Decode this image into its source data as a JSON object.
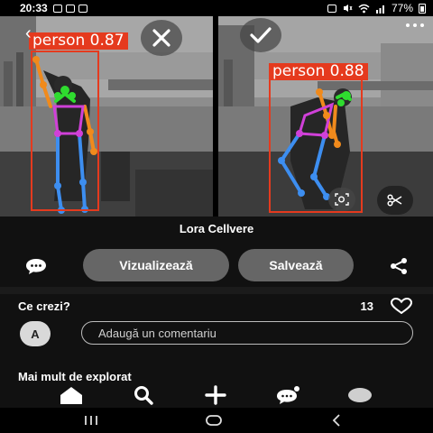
{
  "status_bar": {
    "time": "20:33",
    "battery": "77%",
    "left_icons": [
      "gallery-icon",
      "image-icon",
      "mail-icon"
    ],
    "right_icons": [
      "camera-icon",
      "mute-icon",
      "wifi-icon",
      "signal-icon",
      "battery-icon"
    ]
  },
  "photo_left": {
    "detection_label": "person 0.87",
    "action_icon": "close-icon"
  },
  "photo_right": {
    "detection_label": "person 0.88",
    "action_icon": "check-icon",
    "tools": [
      "lens-search-icon",
      "scissors-icon"
    ]
  },
  "pin": {
    "title": "Lora Cellvere"
  },
  "actions": {
    "comment_icon": "comment-bubble-icon",
    "visit_label": "Vizualizează",
    "save_label": "Salvează",
    "share_icon": "share-icon"
  },
  "comments": {
    "heading": "Ce crezi?",
    "like_count": "13",
    "avatar_letter": "A",
    "input_placeholder": "Adaugă un comentariu"
  },
  "explore": {
    "heading": "Mai mult de explorat"
  },
  "tab_bar": {
    "items": [
      "home-icon",
      "search-icon",
      "create-icon",
      "messages-icon",
      "profile-icon"
    ]
  },
  "system_nav": {
    "items": [
      "recents-icon",
      "home-nav-icon",
      "back-nav-icon"
    ]
  },
  "colors": {
    "detection": "#e53a1e",
    "pill": "#666666",
    "background": "#111111"
  }
}
